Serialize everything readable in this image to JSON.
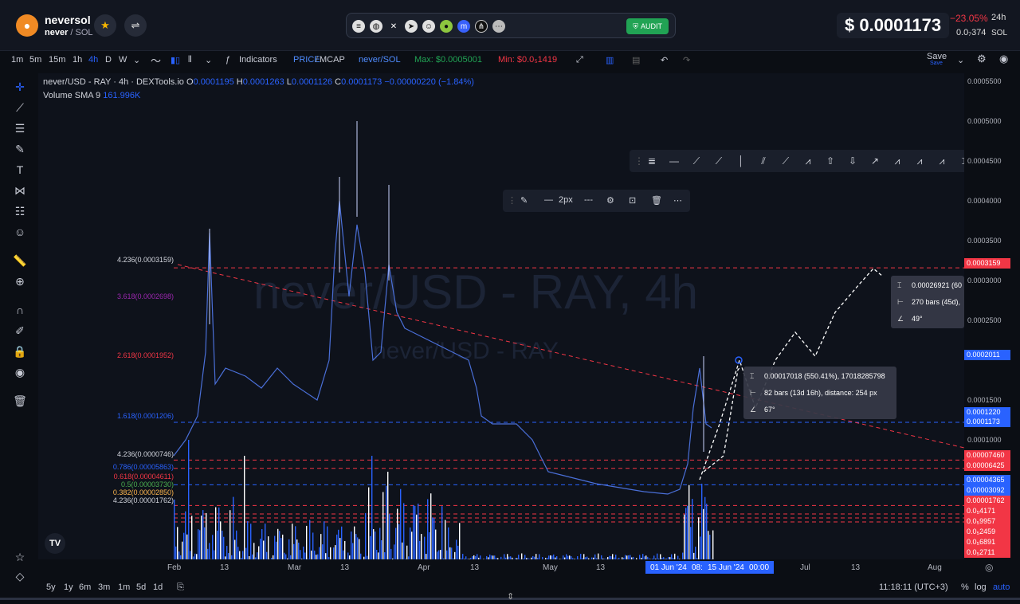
{
  "header": {
    "token_name": "neversol",
    "token_base": "never",
    "token_quote": "SOL",
    "social_icons": [
      "solana-icon",
      "globe-icon",
      "x-icon",
      "telegram-icon",
      "reddit-icon",
      "coingecko-icon",
      "coinmarketcap-icon",
      "dexscreener-icon",
      "more-icon"
    ],
    "audit_label": "AUDIT",
    "price": "$ 0.0001173",
    "change_24h": "−23.05%",
    "change_label": "24h",
    "sol_price": "0.0₇374",
    "sol_label": "SOL"
  },
  "toolbar": {
    "intervals": [
      "1m",
      "5m",
      "15m",
      "1h",
      "4h",
      "D",
      "W"
    ],
    "active_interval": "4h",
    "indicators_label": "Indicators",
    "price_label": "PRICE",
    "mcap_label": "MCAP",
    "pair_label": "never/SOL",
    "max_label": "Max: $0.0005001",
    "min_label": "Min: $0.0₅1419",
    "save_label": "Save",
    "save_sub": "Save"
  },
  "legend": {
    "title": "never/USD - RAY · 4h · DEXTools.io",
    "o_label": "O",
    "o_value": "0.0001195",
    "h_label": "H",
    "h_value": "0.0001263",
    "l_label": "L",
    "l_value": "0.0001126",
    "c_label": "C",
    "c_value": "0.0001173",
    "change": "−0.00000220 (−1.84%)",
    "volume_label": "Volume SMA 9",
    "volume_value": "161.996K"
  },
  "watermark": {
    "main": "never/USD - RAY, 4h",
    "sub": "never/USD - RAY"
  },
  "line_toolbar": {
    "width_label": "2px"
  },
  "fib_labels": [
    {
      "text": "4.236(0.0003159)",
      "color": "#d1d4dc"
    },
    {
      "text": "3.618(0.0002698)",
      "color": "#9c27b0"
    },
    {
      "text": "2.618(0.0001952)",
      "color": "#f23645"
    },
    {
      "text": "1.618(0.0001206)",
      "color": "#2962ff"
    }
  ],
  "fib_labels_small": [
    {
      "text": "4.236(0.0000746)",
      "color": "#d1d4dc"
    },
    {
      "text": "0.786(0.00005863)",
      "color": "#2962ff"
    },
    {
      "text": "0.618(0.00004611)",
      "color": "#f23645"
    },
    {
      "text": "0.5(0.00003730)",
      "color": "#4caf50"
    },
    {
      "text": "0.382(0.00002850)",
      "color": "#ffb74d"
    },
    {
      "text": "4.236(0.00001762)",
      "color": "#d1d4dc"
    }
  ],
  "info_boxes": [
    {
      "line1": "0.00017018 (550.41%), 17018285798",
      "line2": "82 bars (13d 16h), distance: 254 px",
      "line3": "67°"
    },
    {
      "line1": "0.00026921 (60",
      "line2": "270 bars (45d),",
      "line3": "49°"
    }
  ],
  "price_axis": {
    "ticks": [
      "0.0005500",
      "0.0005000",
      "0.0004500",
      "0.0004000",
      "0.0003500",
      "0.0003000",
      "0.0002500",
      "0.0001500",
      "0.0001000"
    ],
    "tags": [
      {
        "text": "0.0003159",
        "color": "#f23645"
      },
      {
        "text": "0.0002011",
        "color": "#2962ff"
      },
      {
        "text": "0.0001220",
        "color": "#2962ff"
      },
      {
        "text": "0.0001173",
        "color": "#2962ff"
      },
      {
        "text": "0.00007460",
        "color": "#f23645"
      },
      {
        "text": "0.00006425",
        "color": "#f23645"
      },
      {
        "text": "0.00004365",
        "color": "#2962ff"
      },
      {
        "text": "0.00003092",
        "color": "#2962ff"
      },
      {
        "text": "0.00001762",
        "color": "#f23645"
      },
      {
        "text": "0.0₅4171",
        "color": "#f23645"
      },
      {
        "text": "0.0₅9957",
        "color": "#f23645"
      },
      {
        "text": "0.0₅2459",
        "color": "#f23645"
      },
      {
        "text": "0.0₅6891",
        "color": "#f23645"
      },
      {
        "text": "0.0₅2711",
        "color": "#f23645"
      }
    ]
  },
  "time_axis": {
    "ticks": [
      "Feb",
      "13",
      "Mar",
      "13",
      "Apr",
      "13",
      "May",
      "13",
      "Jul",
      "13",
      "Aug"
    ],
    "range_start": "01 Jun '24",
    "range_mid": "08:",
    "range_end": "15 Jun '24",
    "range_time": "00:00"
  },
  "bottom": {
    "ranges": [
      "5y",
      "1y",
      "6m",
      "3m",
      "1m",
      "5d",
      "1d"
    ],
    "clock": "11:18:11 (UTC+3)",
    "percent_label": "%",
    "log_label": "log",
    "auto_label": "auto"
  },
  "colors": {
    "accent": "#2962ff",
    "down": "#f23645",
    "up": "#21a354",
    "price_line": "#4a6fd8"
  }
}
